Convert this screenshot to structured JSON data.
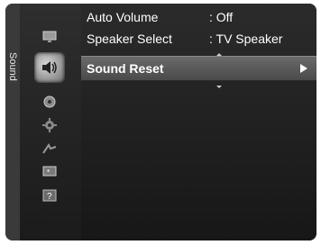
{
  "side_tab": {
    "label": "Sound"
  },
  "menu": {
    "rows": [
      {
        "label": "Auto Volume",
        "value": ": Off"
      },
      {
        "label": "Speaker Select",
        "value": ": TV Speaker"
      },
      {
        "label": "Sound Reset",
        "value": ""
      }
    ],
    "selected_row": "Sound Reset"
  },
  "icons": [
    {
      "name": "picture-icon"
    },
    {
      "name": "sound-speaker-icon"
    },
    {
      "name": "channel-icon"
    },
    {
      "name": "setup-gear-icon"
    },
    {
      "name": "input-icon"
    },
    {
      "name": "application-icon"
    },
    {
      "name": "support-help-icon"
    }
  ],
  "colors": {
    "osd_bg": "#1f1f1f",
    "highlight": "#5a5a5a",
    "text": "#ffffff"
  }
}
